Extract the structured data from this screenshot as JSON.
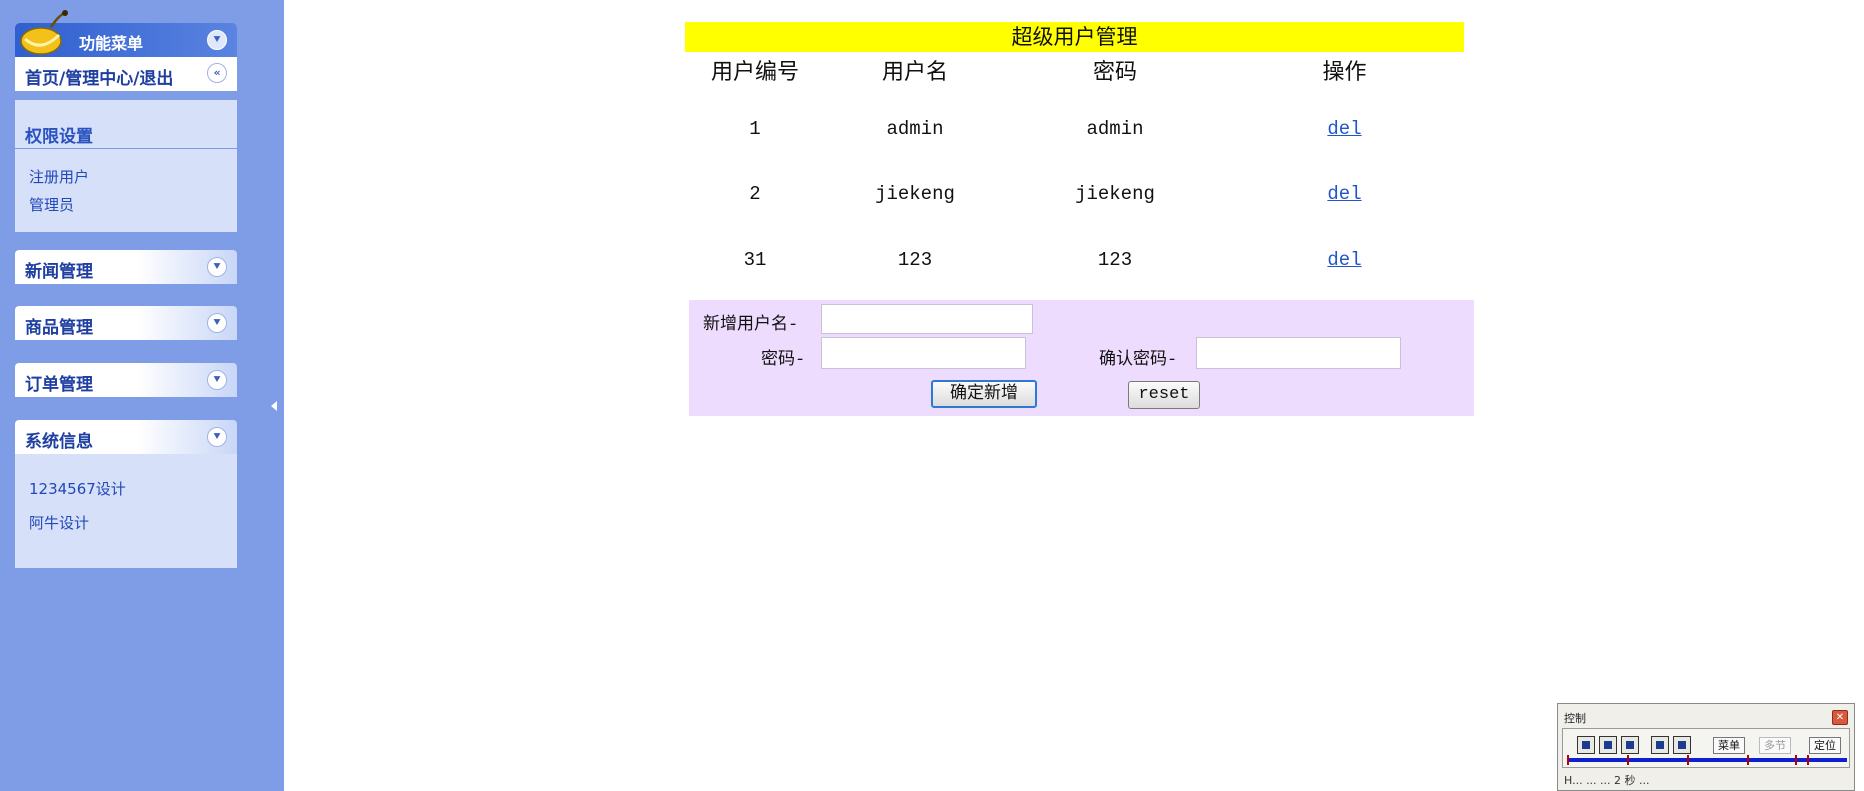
{
  "sidebar": {
    "menu_title": "功能菜单",
    "home_link": "首页/管理中心/退出",
    "permissions": {
      "title": "权限设置",
      "items": [
        "注册用户",
        "管理员"
      ]
    },
    "sections": [
      {
        "title": "新闻管理"
      },
      {
        "title": "商品管理"
      },
      {
        "title": "订单管理"
      },
      {
        "title": "系统信息",
        "items": [
          "1234567设计",
          "阿牛设计"
        ]
      }
    ]
  },
  "main": {
    "title": "超级用户管理",
    "table": {
      "headers": [
        "用户编号",
        "用户名",
        "密码",
        "操作"
      ],
      "rows": [
        {
          "id": "1",
          "username": "admin",
          "password": "admin",
          "action": "del"
        },
        {
          "id": "2",
          "username": "jiekeng",
          "password": "jiekeng",
          "action": "del"
        },
        {
          "id": "31",
          "username": "123",
          "password": "123",
          "action": "del"
        }
      ]
    },
    "form": {
      "new_username_label": "新增用户名-",
      "password_label": "密码-",
      "confirm_password_label": "确认密码-",
      "new_username_value": "",
      "password_value": "",
      "confirm_password_value": "",
      "submit_label": "确定新增",
      "reset_label": "reset"
    }
  },
  "control_widget": {
    "title": "控制",
    "menu_label": "菜单",
    "multi_label": "多节",
    "locate_label": "定位",
    "footer_text": "H... ...  ... 2 秒 ..."
  },
  "colors": {
    "sidebar_bg": "#7e9de6",
    "title_bar": "#ffff00",
    "form_bg": "#eedcff",
    "link": "#2255cc"
  }
}
